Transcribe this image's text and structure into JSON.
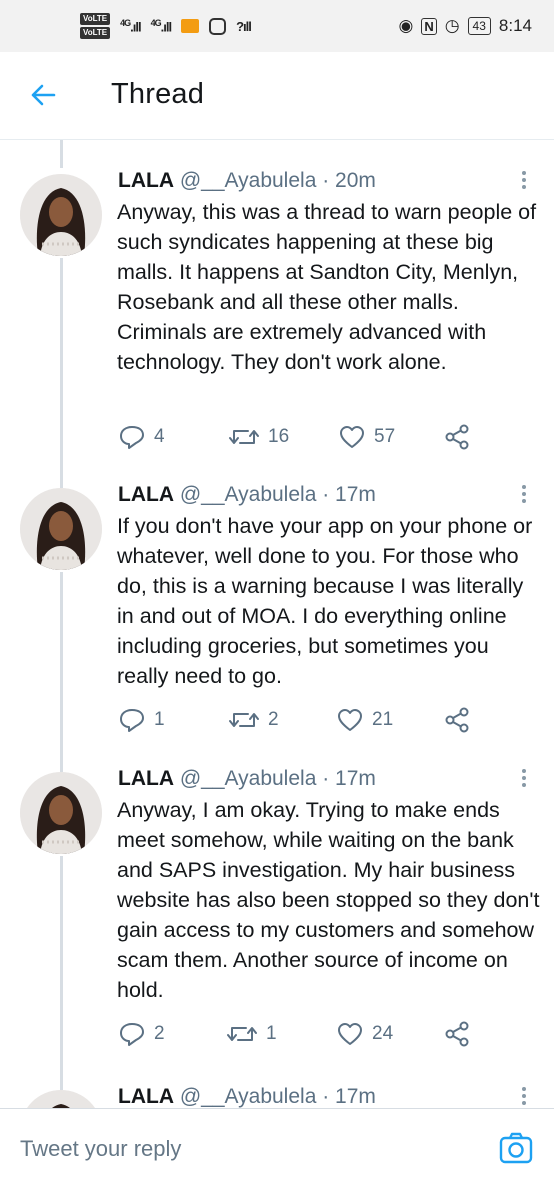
{
  "status_bar": {
    "volte_1": "VoLTE",
    "volte_2": "VoLTE",
    "net_1": "4G",
    "net_2": "4G",
    "time": "8:14",
    "battery": "43"
  },
  "header": {
    "title": "Thread"
  },
  "tweets": [
    {
      "name": "LALA",
      "handle": "@__Ayabulela",
      "time": "· 20m",
      "text": "Anyway, this was a thread to warn people of such syndicates happening at these big malls. It happens at Sandton City, Menlyn, Rosebank and all these other malls. Criminals are extremely advanced with technology. They don't work alone.",
      "replies": "4",
      "retweets": "16",
      "likes": "57"
    },
    {
      "name": "LALA",
      "handle": "@__Ayabulela",
      "time": "· 17m",
      "text": "If you don't have your app on your phone or whatever, well done to you. For those who do, this is a warning because I was literally in and out of MOA. I do everything online including groceries, but sometimes you really need to go.",
      "replies": "1",
      "retweets": "2",
      "likes": "21"
    },
    {
      "name": "LALA",
      "handle": "@__Ayabulela",
      "time": "· 17m",
      "text": "Anyway, I am okay. Trying to make ends meet somehow, while waiting on the bank and SAPS investigation. My hair business website has also been stopped so they don't gain access to my customers and somehow scam them. Another source of income on hold.",
      "replies": "2",
      "retweets": "1",
      "likes": "24"
    },
    {
      "name": "LALA",
      "handle": "@__Ayabulela",
      "time": "· 17m"
    }
  ],
  "reply": {
    "placeholder": "Tweet your reply"
  },
  "colors": {
    "accent": "#1da1f2",
    "icon_gray": "#5b7083",
    "thread_line": "#d7dde3"
  },
  "icons": [
    "back-arrow-icon",
    "more-icon",
    "reply-icon",
    "retweet-icon",
    "like-icon",
    "share-icon",
    "camera-icon"
  ]
}
